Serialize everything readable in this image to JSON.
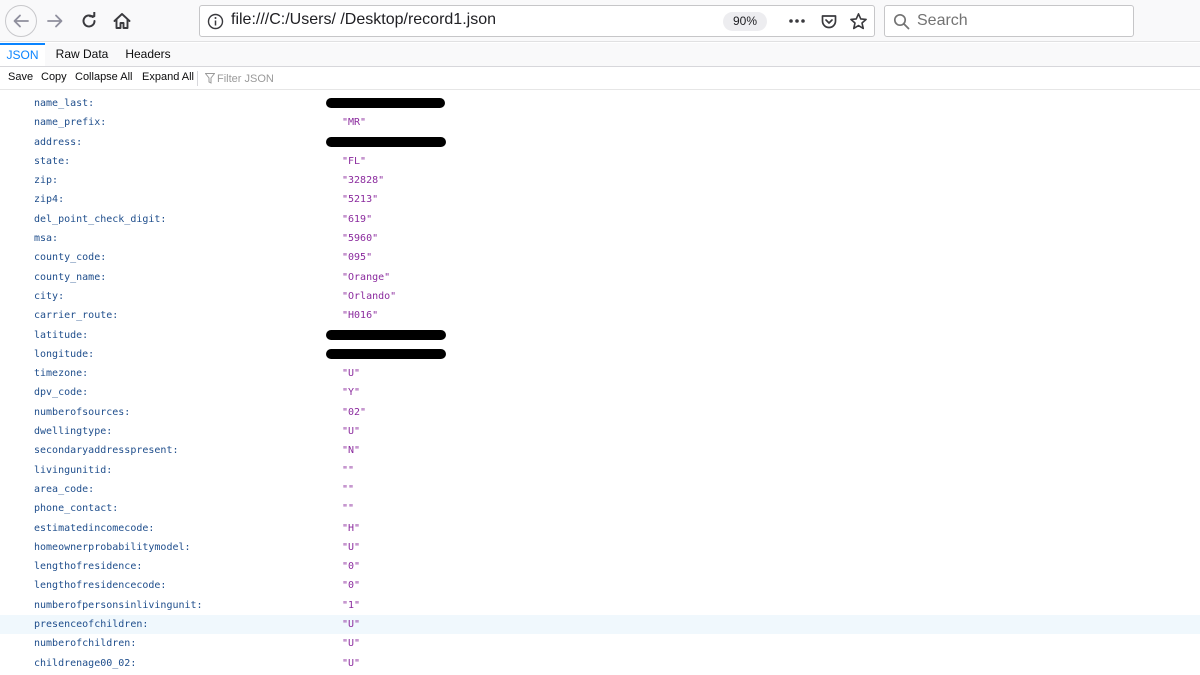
{
  "nav": {
    "url": "file:///C:/Users/          /Desktop/record1.json",
    "zoom": "90%",
    "search_placeholder": "Search"
  },
  "tabs": [
    "JSON",
    "Raw Data",
    "Headers"
  ],
  "toolbar": {
    "save": "Save",
    "copy": "Copy",
    "collapse_all": "Collapse All",
    "expand_all": "Expand All",
    "filter_placeholder": "Filter JSON"
  },
  "rows": [
    {
      "key": "name_last:",
      "value": null,
      "redacted": true
    },
    {
      "key": "name_prefix:",
      "value": "\"MR\""
    },
    {
      "key": "address:",
      "value": null,
      "redacted": true
    },
    {
      "key": "state:",
      "value": "\"FL\""
    },
    {
      "key": "zip:",
      "value": "\"32828\""
    },
    {
      "key": "zip4:",
      "value": "\"5213\""
    },
    {
      "key": "del_point_check_digit:",
      "value": "\"619\""
    },
    {
      "key": "msa:",
      "value": "\"5960\""
    },
    {
      "key": "county_code:",
      "value": "\"095\""
    },
    {
      "key": "county_name:",
      "value": "\"Orange\""
    },
    {
      "key": "city:",
      "value": "\"Orlando\""
    },
    {
      "key": "carrier_route:",
      "value": "\"H016\""
    },
    {
      "key": "latitude:",
      "value": null,
      "redacted": true
    },
    {
      "key": "longitude:",
      "value": null,
      "redacted": true
    },
    {
      "key": "timezone:",
      "value": "\"U\""
    },
    {
      "key": "dpv_code:",
      "value": "\"Y\""
    },
    {
      "key": "numberofsources:",
      "value": "\"02\""
    },
    {
      "key": "dwellingtype:",
      "value": "\"U\""
    },
    {
      "key": "secondaryaddresspresent:",
      "value": "\"N\""
    },
    {
      "key": "livingunitid:",
      "value": "\"\""
    },
    {
      "key": "area_code:",
      "value": "\"\""
    },
    {
      "key": "phone_contact:",
      "value": "\"\""
    },
    {
      "key": "estimatedincomecode:",
      "value": "\"H\""
    },
    {
      "key": "homeownerprobabilitymodel:",
      "value": "\"U\""
    },
    {
      "key": "lengthofresidence:",
      "value": "\"0\""
    },
    {
      "key": "lengthofresidencecode:",
      "value": "\"0\""
    },
    {
      "key": "numberofpersonsinlivingunit:",
      "value": "\"1\""
    },
    {
      "key": "presenceofchildren:",
      "value": "\"U\"",
      "highlighted": true
    },
    {
      "key": "numberofchildren:",
      "value": "\"U\""
    },
    {
      "key": "childrenage00_02:",
      "value": "\"U\""
    }
  ]
}
